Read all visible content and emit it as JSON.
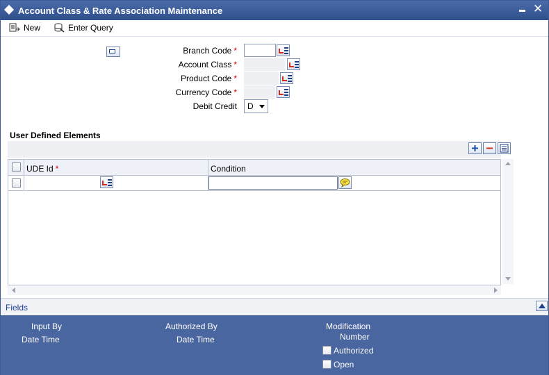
{
  "window": {
    "title": "Account Class & Rate Association Maintenance",
    "minimize_symbol": "",
    "close_symbol": "✕"
  },
  "toolbar": {
    "new_label": "New",
    "enter_query_label": "Enter Query"
  },
  "form": {
    "branch_code": {
      "label": "Branch Code",
      "value": ""
    },
    "account_class": {
      "label": "Account Class",
      "value": ""
    },
    "product_code": {
      "label": "Product Code",
      "value": ""
    },
    "currency_code": {
      "label": "Currency Code",
      "value": ""
    },
    "debit_credit": {
      "label": "Debit Credit",
      "value": "D"
    },
    "required_marker": "*"
  },
  "ude": {
    "section_title": "User Defined Elements",
    "columns": [
      {
        "label": "UDE Id",
        "required": "*"
      },
      {
        "label": "Condition"
      }
    ],
    "rows": [
      {
        "ude_id": "",
        "condition": ""
      }
    ]
  },
  "fields_bar": {
    "label": "Fields"
  },
  "audit": {
    "input_by": "Input By",
    "date_time_1": "Date Time",
    "authorized_by": "Authorized By",
    "date_time_2": "Date Time",
    "modification": "Modification",
    "number": "Number",
    "authorized": "Authorized",
    "open": "Open"
  },
  "colors": {
    "title_bar": "#3b5b99",
    "footer": "#4a66a0",
    "required": "#d00000",
    "link": "#1c3f9a"
  }
}
